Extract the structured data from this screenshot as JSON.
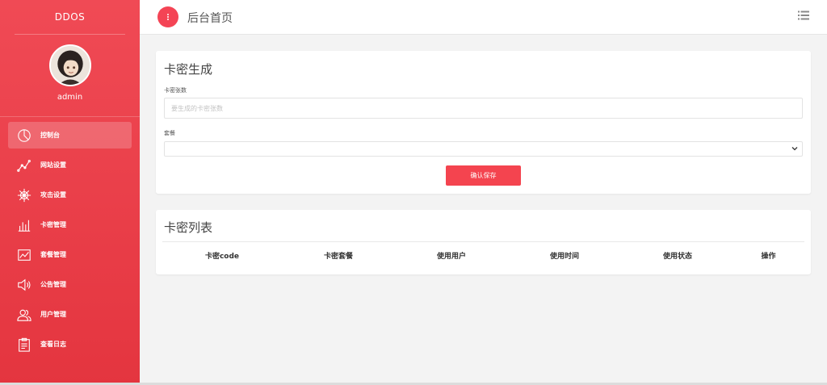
{
  "sidebar": {
    "brand": "DDOS",
    "username": "admin",
    "items": [
      {
        "label": "控制台",
        "icon": "pie-chart-icon",
        "active": true
      },
      {
        "label": "网站设置",
        "icon": "line-trend-icon"
      },
      {
        "label": "攻击设置",
        "icon": "ship-wheel-icon"
      },
      {
        "label": "卡密管理",
        "icon": "bar-chart-icon"
      },
      {
        "label": "套餐管理",
        "icon": "area-chart-icon"
      },
      {
        "label": "公告管理",
        "icon": "speaker-icon"
      },
      {
        "label": "用户管理",
        "icon": "users-icon"
      },
      {
        "label": "查看日志",
        "icon": "clipboard-icon"
      }
    ]
  },
  "header": {
    "title": "后台首页"
  },
  "generate_card": {
    "title": "卡密生成",
    "count_label": "卡密张数",
    "count_placeholder": "要生成的卡密张数",
    "package_label": "套餐",
    "package_value": "",
    "submit_label": "确认保存"
  },
  "list_card": {
    "title": "卡密列表",
    "columns": [
      "卡密code",
      "卡密套餐",
      "使用用户",
      "使用时间",
      "使用状态",
      "操作"
    ]
  },
  "colors": {
    "accent": "#f4444f",
    "sidebar_top": "#f04a55",
    "sidebar_bottom": "#e4353f",
    "background": "#f3f3f3"
  }
}
